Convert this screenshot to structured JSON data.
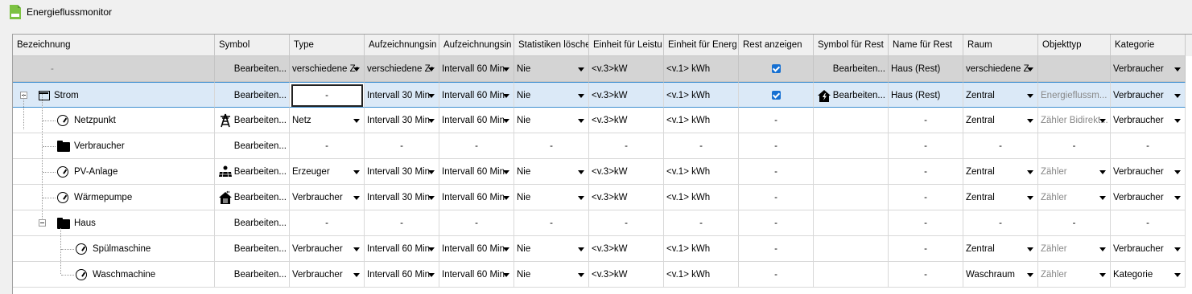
{
  "window": {
    "title": "Energieflussmonitor"
  },
  "columns": [
    "Bezeichnung",
    "Symbol",
    "Type",
    "Aufzeichnungsin",
    "Aufzeichnungsin",
    "Statistiken lösche",
    "Einheit für Leistu",
    "Einheit für Energ",
    "Rest anzeigen",
    "Symbol für Rest",
    "Name für Rest",
    "Raum",
    "Objekttyp",
    "Kategorie"
  ],
  "rows": [
    {
      "name": "-",
      "symbol": "Bearbeiten...",
      "type": "verschiedene Z•",
      "int1": "verschiedene Z•",
      "int2": "Intervall 60 Min",
      "stat": "Nie",
      "einheit_l": "<v.3>kW",
      "einheit_e": "<v.1> kWh",
      "rest": "check",
      "rest_symbol": "Bearbeiten...",
      "rest_name": "Haus (Rest)",
      "raum": "verschiedene Z",
      "objekttyp": "",
      "kategorie": "Verbraucher"
    },
    {
      "name": "Strom",
      "symbol": "Bearbeiten...",
      "type": "-",
      "int1": "Intervall 30 Min",
      "int2": "Intervall 60 Min",
      "stat": "Nie",
      "einheit_l": "<v.3>kW",
      "einheit_e": "<v.1> kWh",
      "rest": "check",
      "rest_symbol": "Bearbeiten...",
      "rest_name": "Haus (Rest)",
      "raum": "Zentral",
      "objekttyp": "Energieflussm...",
      "kategorie": "Verbraucher"
    },
    {
      "name": "Netzpunkt",
      "symbol": "Bearbeiten...",
      "type": "Netz",
      "int1": "Intervall 30 Min",
      "int2": "Intervall 60 Min",
      "stat": "Nie",
      "einheit_l": "<v.3>kW",
      "einheit_e": "<v.1> kWh",
      "rest": "-",
      "rest_symbol": "",
      "rest_name": "-",
      "raum": "Zentral",
      "objekttyp": "Zähler Bidirekt...",
      "kategorie": "Verbraucher"
    },
    {
      "name": "Verbraucher",
      "symbol": "Bearbeiten...",
      "type": "-",
      "int1": "-",
      "int2": "-",
      "stat": "-",
      "einheit_l": "-",
      "einheit_e": "-",
      "rest": "-",
      "rest_symbol": "",
      "rest_name": "-",
      "raum": "-",
      "objekttyp": "-",
      "kategorie": "-"
    },
    {
      "name": "PV-Anlage",
      "symbol": "Bearbeiten...",
      "type": "Erzeuger",
      "int1": "Intervall 30 Min",
      "int2": "Intervall 60 Min",
      "stat": "Nie",
      "einheit_l": "<v.3>kW",
      "einheit_e": "<v.1> kWh",
      "rest": "-",
      "rest_symbol": "",
      "rest_name": "-",
      "raum": "Zentral",
      "objekttyp": "Zähler",
      "kategorie": "Verbraucher"
    },
    {
      "name": "Wärmepumpe",
      "symbol": "Bearbeiten...",
      "type": "Verbraucher",
      "int1": "Intervall 30 Min",
      "int2": "Intervall 60 Min",
      "stat": "Nie",
      "einheit_l": "<v.3>kW",
      "einheit_e": "<v.1> kWh",
      "rest": "-",
      "rest_symbol": "",
      "rest_name": "-",
      "raum": "Zentral",
      "objekttyp": "Zähler",
      "kategorie": "Verbraucher"
    },
    {
      "name": "Haus",
      "symbol": "Bearbeiten...",
      "type": "-",
      "int1": "-",
      "int2": "-",
      "stat": "-",
      "einheit_l": "-",
      "einheit_e": "-",
      "rest": "-",
      "rest_symbol": "",
      "rest_name": "-",
      "raum": "-",
      "objekttyp": "-",
      "kategorie": "-"
    },
    {
      "name": "Spülmaschine",
      "symbol": "Bearbeiten...",
      "type": "Verbraucher",
      "int1": "Intervall 60 Min",
      "int2": "Intervall 60 Min",
      "stat": "Nie",
      "einheit_l": "<v.3>kW",
      "einheit_e": "<v.1> kWh",
      "rest": "-",
      "rest_symbol": "",
      "rest_name": "-",
      "raum": "Zentral",
      "objekttyp": "Zähler",
      "kategorie": "Verbraucher"
    },
    {
      "name": "Waschmachine",
      "symbol": "Bearbeiten...",
      "type": "Verbraucher",
      "int1": "Intervall 60 Min",
      "int2": "Intervall 60 Min",
      "stat": "Nie",
      "einheit_l": "<v.3>kW",
      "einheit_e": "<v.1> kWh",
      "rest": "-",
      "rest_symbol": "",
      "rest_name": "-",
      "raum": "Waschraum",
      "objekttyp": "Zähler",
      "kategorie": "Kategorie"
    }
  ]
}
